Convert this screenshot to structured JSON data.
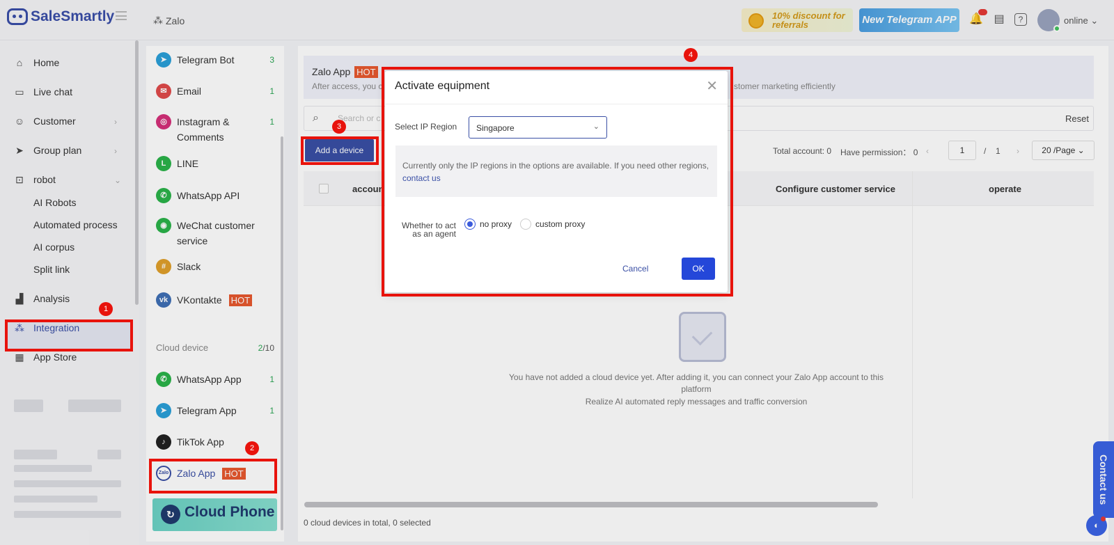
{
  "app": {
    "brand": "SaleSmartly",
    "breadcrumb": "Zalo"
  },
  "topbar": {
    "promo_discount": "10% discount for referrals",
    "promo_telegram": "New Telegram APP",
    "status": "online"
  },
  "sidebar": {
    "items": [
      {
        "label": "Home",
        "icon": "home-icon"
      },
      {
        "label": "Live chat",
        "icon": "chat-icon"
      },
      {
        "label": "Customer",
        "icon": "users-icon"
      },
      {
        "label": "Group plan",
        "icon": "send-icon"
      },
      {
        "label": "robot",
        "icon": "robot-icon"
      },
      {
        "label": "AI Robots"
      },
      {
        "label": "Automated process"
      },
      {
        "label": "AI corpus"
      },
      {
        "label": "Split link"
      },
      {
        "label": "Analysis",
        "icon": "chart-icon"
      },
      {
        "label": "Integration",
        "icon": "integration-icon"
      },
      {
        "label": "App Store",
        "icon": "grid-icon"
      }
    ]
  },
  "channels": {
    "items": [
      {
        "label": "Telegram Bot",
        "count": "3",
        "color": "#2ba0d9"
      },
      {
        "label": "Email",
        "count": "1",
        "color": "#e04b4b"
      },
      {
        "label": "Instagram &",
        "label2": "Comments",
        "count": "1",
        "color": "#d6307a"
      },
      {
        "label": "LINE",
        "count": "",
        "color": "#2bb34a"
      },
      {
        "label": "WhatsApp API",
        "count": "",
        "color": "#2bb34a"
      },
      {
        "label": "WeChat customer",
        "label2": "service",
        "count": "",
        "color": "#2bb34a"
      },
      {
        "label": "Slack",
        "count": "",
        "color": "#e0a02a"
      },
      {
        "label": "VKontakte",
        "count": "",
        "color": "#3f6fb5",
        "hot": "HOT"
      }
    ],
    "cloud_label": "Cloud device",
    "cloud_used": "2",
    "cloud_total": "/10",
    "cloud_items": [
      {
        "label": "WhatsApp App",
        "count": "1",
        "color": "#2bb34a"
      },
      {
        "label": "Telegram App",
        "count": "1",
        "color": "#2ba0d9"
      },
      {
        "label": "TikTok App",
        "count": "",
        "color": "#222222"
      },
      {
        "label": "Zalo App",
        "count": "",
        "color": "#3a4fa5",
        "hot": "HOT"
      }
    ],
    "cloud_phone": "Cloud Phone"
  },
  "main": {
    "title": "Zalo App",
    "hot": "HOT",
    "desc_left": "After access, you c",
    "desc_right": "stomer marketing efficiently",
    "search_placeholder": "Search or c",
    "reset": "Reset",
    "add_device": "Add a device",
    "total_account": "Total account: 0",
    "have_permission": "Have permission： 0",
    "page_current": "1",
    "page_sep": "/",
    "page_total": "1",
    "page_size": "20 /Page",
    "col_account": "accoun",
    "col_service": "Configure customer service",
    "col_operate": "operate",
    "empty_line1": "You have not added a cloud device yet. After adding it, you can connect your Zalo App account to this",
    "empty_line2": "platform",
    "empty_line3": "Realize AI automated reply messages and traffic conversion",
    "footer": "0 cloud devices in total, 0 selected"
  },
  "contact_tab": "Contact us",
  "modal": {
    "title": "Activate equipment",
    "ip_label": "Select IP Region",
    "ip_value": "Singapore",
    "notice": "Currently only the IP regions in the options are available. If you need other regions,",
    "notice_link": "contact us",
    "agent_label_1": "Whether to act",
    "agent_label_2": "as an agent",
    "opt_no_proxy": "no proxy",
    "opt_custom_proxy": "custom proxy",
    "selected_option": "no proxy",
    "cancel": "Cancel",
    "ok": "OK"
  },
  "markers": [
    "1",
    "2",
    "3",
    "4"
  ],
  "colors": {
    "accent": "#3a4fa5",
    "highlight": "#e8130c",
    "hot": "#e8592f",
    "ok": "#2447d9"
  }
}
